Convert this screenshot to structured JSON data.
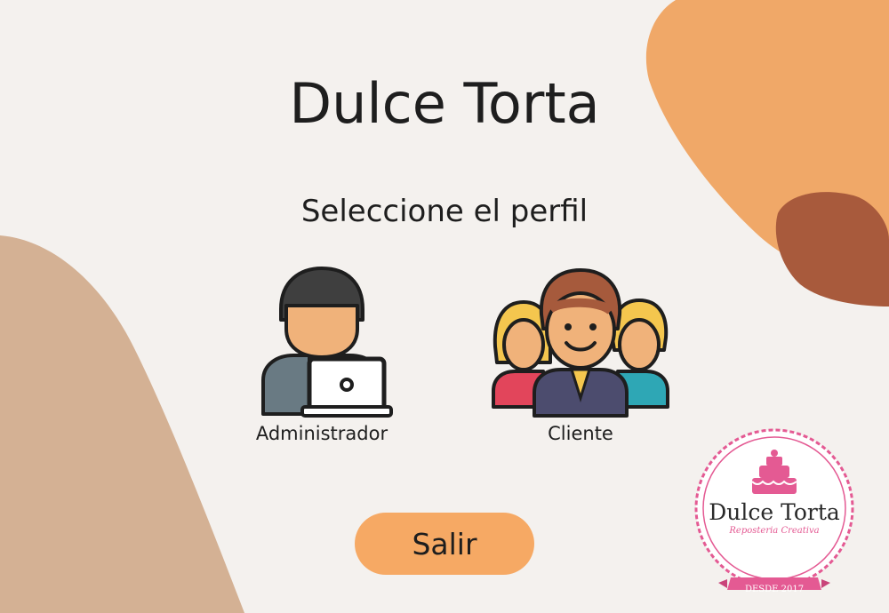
{
  "app": {
    "title": "Dulce Torta",
    "subtitle": "Seleccione el perfil"
  },
  "profiles": [
    {
      "label": "Administrador",
      "icon": "admin-laptop-icon"
    },
    {
      "label": "Cliente",
      "icon": "client-group-icon"
    }
  ],
  "actions": {
    "exit_label": "Salir"
  },
  "logo": {
    "title": "Dulce Torta",
    "subtitle": "Reposteria Creativa",
    "since": "DESDE 2017"
  },
  "colors": {
    "background": "#f4f1ee",
    "blob_left": "#d4b194",
    "blob_right": "#f0a868",
    "blob_right_dark": "#a85a3c",
    "button": "#f6a964",
    "logo_pink": "#e45a93"
  }
}
